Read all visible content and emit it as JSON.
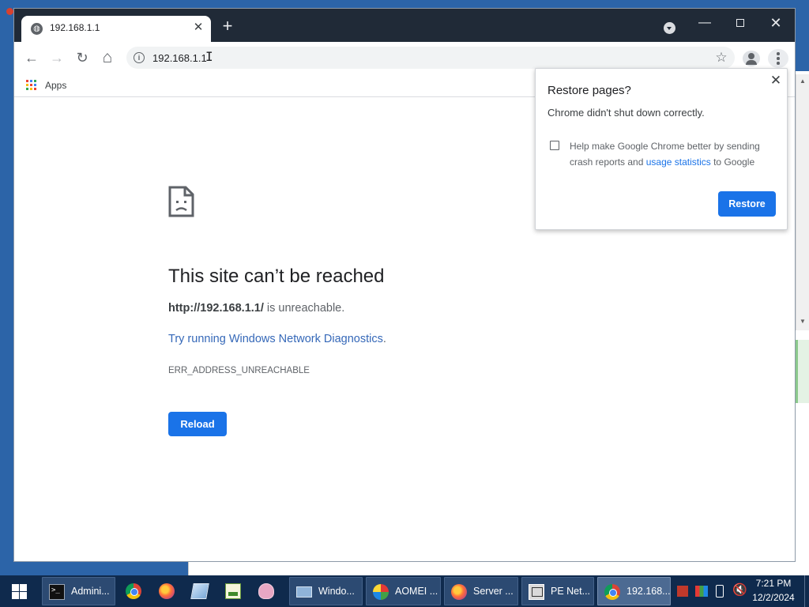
{
  "browser": {
    "tab": {
      "title": "192.168.1.1",
      "close_glyph": "✕"
    },
    "new_tab_glyph": "+",
    "window_controls": {
      "minimize": "—",
      "close": "✕"
    },
    "toolbar": {
      "back_glyph": "←",
      "forward_glyph": "→",
      "reload_glyph": "↻",
      "home_glyph": "⌂",
      "address": "192.168.1.1",
      "bookmark_glyph": "☆"
    },
    "bookmarks_bar": {
      "apps_label": "Apps"
    }
  },
  "error_page": {
    "headline": "This site can’t be reached",
    "url": "http://192.168.1.1/",
    "url_suffix": " is unreachable.",
    "diagnostics_link": "Try running Windows Network Diagnostics",
    "diagnostics_period": ".",
    "error_code": "ERR_ADDRESS_UNREACHABLE",
    "reload_label": "Reload"
  },
  "restore_dialog": {
    "title": "Restore pages?",
    "message": "Chrome didn't shut down correctly.",
    "help_text_start": "Help make Google Chrome better by sending crash reports and ",
    "help_link": "usage statistics",
    "help_text_end": " to Google",
    "checkbox_checked": false,
    "restore_label": "Restore",
    "close_glyph": "✕"
  },
  "taskbar": {
    "items": [
      {
        "label": "Admini...",
        "icon": "cmd-icon"
      },
      {
        "label": "",
        "icon": "chrome-icon"
      },
      {
        "label": "",
        "icon": "firefox-icon"
      },
      {
        "label": "",
        "icon": "document-icon"
      },
      {
        "label": "",
        "icon": "notepad-icon"
      },
      {
        "label": "",
        "icon": "brain-icon"
      },
      {
        "label": "Windo...",
        "icon": "laptop-icon"
      },
      {
        "label": "AOMEI ...",
        "icon": "aomei-icon"
      },
      {
        "label": "Server ...",
        "icon": "firefox-icon"
      },
      {
        "label": "PE Net...",
        "icon": "network-icon"
      },
      {
        "label": "192.168...",
        "icon": "chrome-icon"
      }
    ],
    "clock": {
      "time": "7:21 PM",
      "date": "12/2/2024"
    }
  },
  "colors": {
    "accent_blue": "#1a73e8",
    "titlebar": "#202a37",
    "taskbar": "#0f2a4d"
  }
}
